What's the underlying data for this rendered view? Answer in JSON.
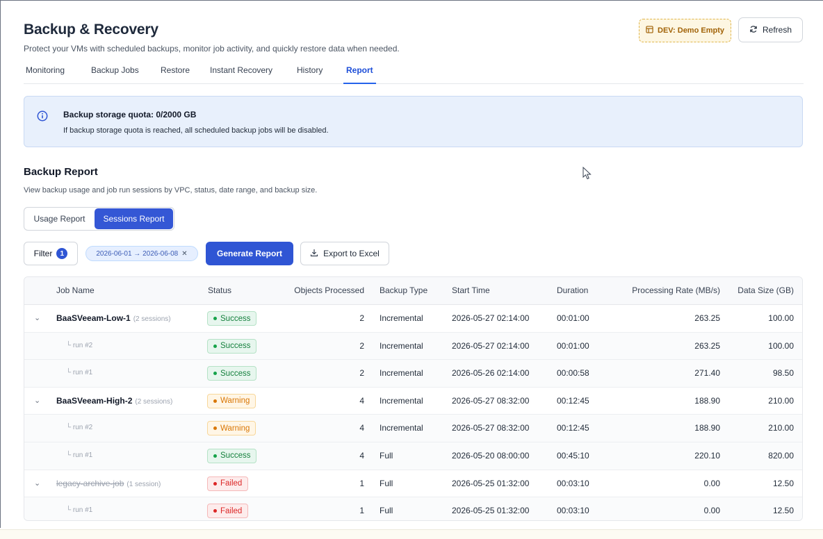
{
  "header": {
    "title": "Backup & Recovery",
    "subtitle": "Protect your VMs with scheduled backups, monitor job activity, and quickly restore data when needed.",
    "env_badge": "DEV: Demo Empty",
    "refresh_label": "Refresh"
  },
  "tabs": [
    {
      "label": "Monitoring"
    },
    {
      "label": "Backup Jobs"
    },
    {
      "label": "Restore"
    },
    {
      "label": "Instant Recovery"
    },
    {
      "label": "History"
    },
    {
      "label": "Report",
      "active": true
    }
  ],
  "quota": {
    "title": "Backup storage quota: 0/2000 GB",
    "text": "If backup storage quota is reached, all scheduled backup jobs will be disabled."
  },
  "report": {
    "title": "Backup Report",
    "subtitle": "View backup usage and job run sessions by VPC, status, date range, and backup size.",
    "segments": {
      "usage": "Usage Report",
      "sessions": "Sessions Report",
      "active": "sessions"
    },
    "filter_label": "Filter",
    "filter_count": "1",
    "date_chip": "2026-06-01 → 2026-06-08",
    "generate_label": "Generate Report",
    "export_label": "Export to Excel"
  },
  "table": {
    "columns": [
      "Job Name",
      "Status",
      "Objects Processed",
      "Backup Type",
      "Start Time",
      "Duration",
      "Processing Rate (MB/s)",
      "Data Size (GB)"
    ],
    "rows": [
      {
        "kind": "group",
        "name": "BaaSVeeam-Low-1",
        "sessions": "(2 sessions)",
        "status": "Success",
        "objects": "2",
        "type": "Incremental",
        "start": "2026-05-27 02:14:00",
        "duration": "00:01:00",
        "rate": "263.25",
        "size": "100.00"
      },
      {
        "kind": "child",
        "name": "└ run #2",
        "status": "Success",
        "objects": "2",
        "type": "Incremental",
        "start": "2026-05-27 02:14:00",
        "duration": "00:01:00",
        "rate": "263.25",
        "size": "100.00"
      },
      {
        "kind": "child",
        "name": "└ run #1",
        "status": "Success",
        "objects": "2",
        "type": "Incremental",
        "start": "2026-05-26 02:14:00",
        "duration": "00:00:58",
        "rate": "271.40",
        "size": "98.50"
      },
      {
        "kind": "group",
        "name": "BaaSVeeam-High-2",
        "sessions": "(2 sessions)",
        "status": "Warning",
        "objects": "4",
        "type": "Incremental",
        "start": "2026-05-27 08:32:00",
        "duration": "00:12:45",
        "rate": "188.90",
        "size": "210.00"
      },
      {
        "kind": "child",
        "name": "└ run #2",
        "status": "Warning",
        "objects": "4",
        "type": "Incremental",
        "start": "2026-05-27 08:32:00",
        "duration": "00:12:45",
        "rate": "188.90",
        "size": "210.00"
      },
      {
        "kind": "child",
        "name": "└ run #1",
        "status": "Success",
        "objects": "4",
        "type": "Full",
        "start": "2026-05-20 08:00:00",
        "duration": "00:45:10",
        "rate": "220.10",
        "size": "820.00"
      },
      {
        "kind": "group",
        "name": "legacy-archive-job",
        "sessions": "(1 session)",
        "struck": true,
        "status": "Failed",
        "objects": "1",
        "type": "Full",
        "start": "2026-05-25 01:32:00",
        "duration": "00:03:10",
        "rate": "0.00",
        "size": "12.50"
      },
      {
        "kind": "child",
        "name": "└ run #1",
        "status": "Failed",
        "objects": "1",
        "type": "Full",
        "start": "2026-05-25 01:32:00",
        "duration": "00:03:10",
        "rate": "0.00",
        "size": "12.50"
      }
    ]
  },
  "icons": {
    "env": "layout-icon",
    "refresh": "refresh-icon",
    "info": "info-icon",
    "export": "download-icon",
    "chevron": "chevron-down-icon"
  },
  "colors": {
    "accent": "#2f55d4",
    "success": "#15803d",
    "warning": "#d97706",
    "failed": "#dc2626",
    "quota_bg": "#e8f0fc"
  }
}
